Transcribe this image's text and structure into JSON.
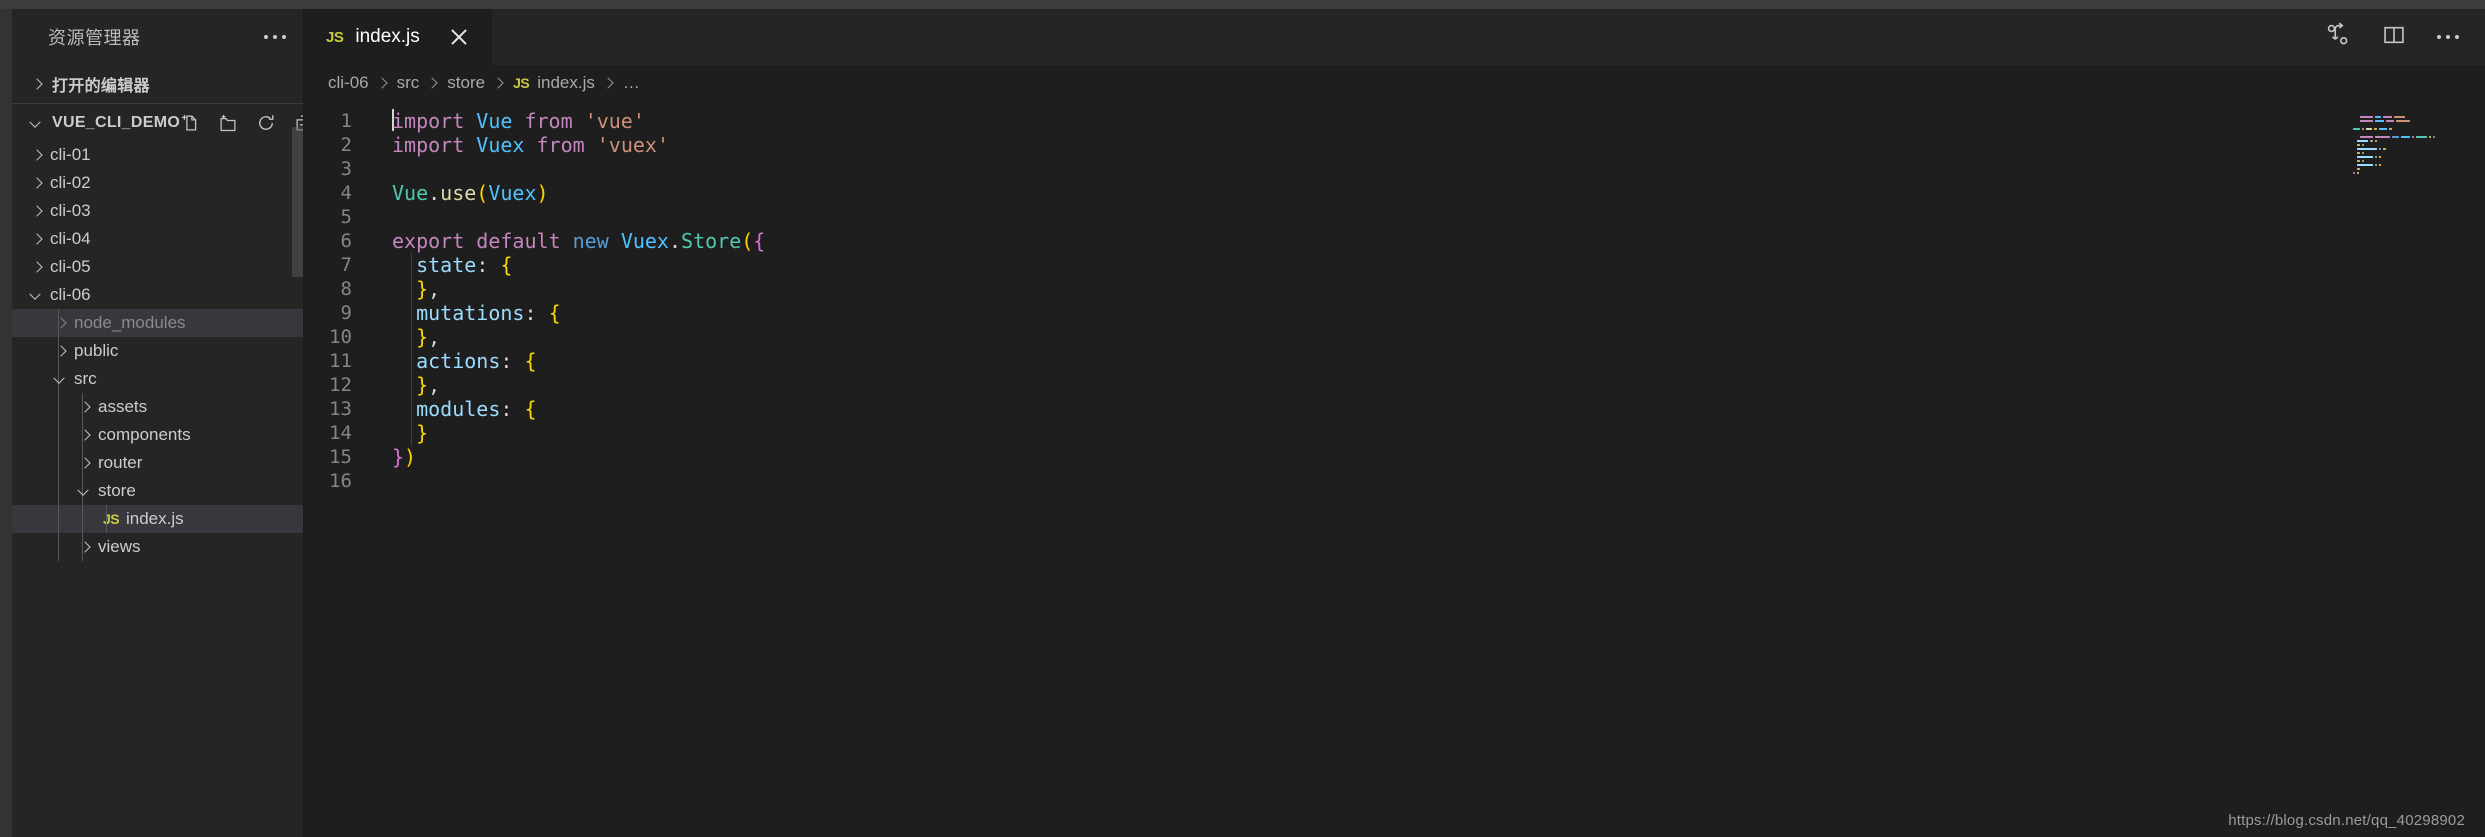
{
  "window": {
    "accent_js": "#cbcb41",
    "bg_editor": "#1e1e1e",
    "bg_sidebar": "#252526",
    "bg_selection": "#37373d"
  },
  "sidebar": {
    "title": "资源管理器",
    "more_actions_icon": "more-horizontal-icon",
    "open_editors": {
      "label": "打开的编辑器",
      "expanded": false,
      "chevron_icon": "chevron-right-icon"
    },
    "workspace": {
      "label": "VUE_CLI_DEMO",
      "expanded": true,
      "chevron_icon": "chevron-down-icon",
      "actions": [
        {
          "name": "new-file-icon",
          "title": "新建文件"
        },
        {
          "name": "new-folder-icon",
          "title": "新建文件夹"
        },
        {
          "name": "refresh-icon",
          "title": "刷新资源管理器"
        },
        {
          "name": "collapse-all-icon",
          "title": "在资源管理器中折叠文件夹"
        }
      ]
    },
    "tree": [
      {
        "label": "cli-01",
        "depth": 1,
        "type": "folder",
        "expanded": false,
        "state": "normal"
      },
      {
        "label": "cli-02",
        "depth": 1,
        "type": "folder",
        "expanded": false,
        "state": "normal"
      },
      {
        "label": "cli-03",
        "depth": 1,
        "type": "folder",
        "expanded": false,
        "state": "normal"
      },
      {
        "label": "cli-04",
        "depth": 1,
        "type": "folder",
        "expanded": false,
        "state": "normal"
      },
      {
        "label": "cli-05",
        "depth": 1,
        "type": "folder",
        "expanded": false,
        "state": "normal"
      },
      {
        "label": "cli-06",
        "depth": 1,
        "type": "folder",
        "expanded": true,
        "state": "normal"
      },
      {
        "label": "node_modules",
        "depth": 2,
        "type": "folder",
        "expanded": false,
        "state": "dim-hover"
      },
      {
        "label": "public",
        "depth": 2,
        "type": "folder",
        "expanded": false,
        "state": "normal"
      },
      {
        "label": "src",
        "depth": 2,
        "type": "folder",
        "expanded": true,
        "state": "normal"
      },
      {
        "label": "assets",
        "depth": 3,
        "type": "folder",
        "expanded": false,
        "state": "normal"
      },
      {
        "label": "components",
        "depth": 3,
        "type": "folder",
        "expanded": false,
        "state": "normal"
      },
      {
        "label": "router",
        "depth": 3,
        "type": "folder",
        "expanded": false,
        "state": "normal"
      },
      {
        "label": "store",
        "depth": 3,
        "type": "folder",
        "expanded": true,
        "state": "normal"
      },
      {
        "label": "index.js",
        "depth": 4,
        "type": "file-js",
        "badge": "JS",
        "state": "selected"
      },
      {
        "label": "views",
        "depth": 3,
        "type": "folder",
        "expanded": false,
        "state": "normal"
      }
    ]
  },
  "editor": {
    "tab": {
      "badge": "JS",
      "label": "index.js",
      "close_icon": "close-icon",
      "active": true
    },
    "tab_actions": [
      {
        "name": "split-source-control-icon"
      },
      {
        "name": "split-editor-icon"
      },
      {
        "name": "more-actions-icon"
      }
    ],
    "breadcrumbs": [
      {
        "label": "cli-06",
        "badge": null
      },
      {
        "label": "src",
        "badge": null
      },
      {
        "label": "store",
        "badge": null
      },
      {
        "label": "index.js",
        "badge": "JS"
      },
      {
        "label": "…",
        "badge": null
      }
    ],
    "cursor_line": 1,
    "line_numbers": [
      1,
      2,
      3,
      4,
      5,
      6,
      7,
      8,
      9,
      10,
      11,
      12,
      13,
      14,
      15,
      16
    ],
    "code": [
      {
        "n": 1,
        "tokens": [
          {
            "t": "import",
            "c": "t-kw"
          },
          {
            "t": " ",
            "c": "t-pun"
          },
          {
            "t": "Vue",
            "c": "t-type"
          },
          {
            "t": " ",
            "c": "t-pun"
          },
          {
            "t": "from",
            "c": "t-kw"
          },
          {
            "t": " ",
            "c": "t-pun"
          },
          {
            "t": "'vue'",
            "c": "t-str"
          }
        ]
      },
      {
        "n": 2,
        "tokens": [
          {
            "t": "import",
            "c": "t-kw"
          },
          {
            "t": " ",
            "c": "t-pun"
          },
          {
            "t": "Vuex",
            "c": "t-type"
          },
          {
            "t": " ",
            "c": "t-pun"
          },
          {
            "t": "from",
            "c": "t-kw"
          },
          {
            "t": " ",
            "c": "t-pun"
          },
          {
            "t": "'vuex'",
            "c": "t-str"
          }
        ]
      },
      {
        "n": 3,
        "tokens": []
      },
      {
        "n": 4,
        "tokens": [
          {
            "t": "Vue",
            "c": "t-cls"
          },
          {
            "t": ".",
            "c": "t-pun"
          },
          {
            "t": "use",
            "c": "t-fn"
          },
          {
            "t": "(",
            "c": "t-brk1"
          },
          {
            "t": "Vuex",
            "c": "t-type"
          },
          {
            "t": ")",
            "c": "t-brk1"
          }
        ]
      },
      {
        "n": 5,
        "tokens": []
      },
      {
        "n": 6,
        "tokens": [
          {
            "t": "export",
            "c": "t-kw"
          },
          {
            "t": " ",
            "c": "t-pun"
          },
          {
            "t": "default",
            "c": "t-kw"
          },
          {
            "t": " ",
            "c": "t-pun"
          },
          {
            "t": "new",
            "c": "t-kw2"
          },
          {
            "t": " ",
            "c": "t-pun"
          },
          {
            "t": "Vuex",
            "c": "t-type"
          },
          {
            "t": ".",
            "c": "t-pun"
          },
          {
            "t": "Store",
            "c": "t-cls"
          },
          {
            "t": "(",
            "c": "t-brk1"
          },
          {
            "t": "{",
            "c": "t-brk2"
          }
        ]
      },
      {
        "n": 7,
        "tokens": [
          {
            "t": "  ",
            "c": "t-pun"
          },
          {
            "t": "state",
            "c": "t-prop"
          },
          {
            "t": ": ",
            "c": "t-pun"
          },
          {
            "t": "{",
            "c": "t-brk1"
          }
        ]
      },
      {
        "n": 8,
        "tokens": [
          {
            "t": "  ",
            "c": "t-pun"
          },
          {
            "t": "}",
            "c": "t-brk1"
          },
          {
            "t": ",",
            "c": "t-pun"
          }
        ]
      },
      {
        "n": 9,
        "tokens": [
          {
            "t": "  ",
            "c": "t-pun"
          },
          {
            "t": "mutations",
            "c": "t-prop"
          },
          {
            "t": ": ",
            "c": "t-pun"
          },
          {
            "t": "{",
            "c": "t-brk1"
          }
        ]
      },
      {
        "n": 10,
        "tokens": [
          {
            "t": "  ",
            "c": "t-pun"
          },
          {
            "t": "}",
            "c": "t-brk1"
          },
          {
            "t": ",",
            "c": "t-pun"
          }
        ]
      },
      {
        "n": 11,
        "tokens": [
          {
            "t": "  ",
            "c": "t-pun"
          },
          {
            "t": "actions",
            "c": "t-prop"
          },
          {
            "t": ": ",
            "c": "t-pun"
          },
          {
            "t": "{",
            "c": "t-brk1"
          }
        ]
      },
      {
        "n": 12,
        "tokens": [
          {
            "t": "  ",
            "c": "t-pun"
          },
          {
            "t": "}",
            "c": "t-brk1"
          },
          {
            "t": ",",
            "c": "t-pun"
          }
        ]
      },
      {
        "n": 13,
        "tokens": [
          {
            "t": "  ",
            "c": "t-pun"
          },
          {
            "t": "modules",
            "c": "t-prop"
          },
          {
            "t": ": ",
            "c": "t-pun"
          },
          {
            "t": "{",
            "c": "t-brk1"
          }
        ]
      },
      {
        "n": 14,
        "tokens": [
          {
            "t": "  ",
            "c": "t-pun"
          },
          {
            "t": "}",
            "c": "t-brk1"
          }
        ]
      },
      {
        "n": 15,
        "tokens": [
          {
            "t": "}",
            "c": "t-brk2"
          },
          {
            "t": ")",
            "c": "t-brk1"
          }
        ]
      },
      {
        "n": 16,
        "tokens": []
      }
    ]
  },
  "watermark": "https://blog.csdn.net/qq_40298902"
}
